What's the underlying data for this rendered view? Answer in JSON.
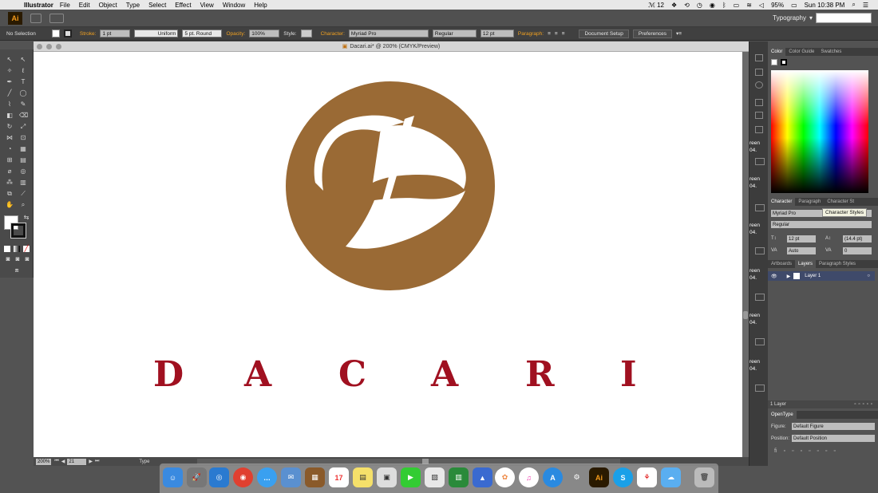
{
  "menubar": {
    "app_name": "Illustrator",
    "items": [
      "File",
      "Edit",
      "Object",
      "Type",
      "Select",
      "Effect",
      "View",
      "Window",
      "Help"
    ],
    "status": {
      "notifications": "12",
      "battery": "95%",
      "clock": "Sun 10:38 PM"
    }
  },
  "appbar": {
    "logo": "Ai",
    "workspace": "Typography"
  },
  "control": {
    "selection": "No Selection",
    "stroke_label": "Stroke:",
    "stroke_value": "1 pt",
    "profile": "Uniform",
    "brush": "5 pt. Round",
    "opacity_label": "Opacity:",
    "opacity_value": "100%",
    "style_label": "Style:",
    "character_label": "Character:",
    "font": "Myriad Pro",
    "font_style": "Regular",
    "font_size": "12 pt",
    "paragraph_label": "Paragraph:",
    "document_setup": "Document Setup",
    "preferences": "Preferences"
  },
  "document": {
    "title": "Dacari.ai* @ 200% (CMYK/Preview)",
    "wordmark": [
      "D",
      "A",
      "C",
      "A",
      "R",
      "I"
    ],
    "status_zoom": "200%",
    "status_page": "21",
    "status_tool": "Type"
  },
  "colors": {
    "logo_brown": "#9a6a35",
    "wordmark_red": "#a01020"
  },
  "side_strip": {
    "items": [
      "reen",
      "04.",
      "reen",
      "04.",
      "reen",
      "04.",
      "reen",
      "04.",
      "reen",
      "04.",
      "reen",
      "04."
    ]
  },
  "panels": {
    "color_tabs": [
      "Color",
      "Color Guide",
      "Swatches"
    ],
    "character_tabs": [
      "Character",
      "Paragraph",
      "Character St"
    ],
    "tooltip": "Character Styles",
    "char_font": "Myriad Pro",
    "char_style": "Regular",
    "char_size": "12 pt",
    "char_leading": "(14.4 pt)",
    "char_kerning": "Auto",
    "char_tracking": "0",
    "layers_tabs": [
      "Artboards",
      "Layers",
      "Paragraph Styles"
    ],
    "layer_name": "Layer 1",
    "layers_count": "1 Layer",
    "opentype_title": "OpenType",
    "figure_label": "Figure:",
    "figure_value": "Default Figure",
    "position_label": "Position:",
    "position_value": "Default Position"
  },
  "dock": {
    "items": [
      "finder-icon",
      "launchpad-icon",
      "safari-icon",
      "chrome-icon",
      "messages-icon",
      "mail-icon",
      "notes-icon",
      "calendar-icon",
      "stickies-icon",
      "preview-icon",
      "facetime-icon",
      "photos-icon",
      "numbers-icon",
      "keynote-icon",
      "photos-app-icon",
      "itunes-icon",
      "appstore-icon",
      "system-preferences-icon",
      "illustrator-icon",
      "skype-icon",
      "acrobat-icon",
      "icloud-icon",
      "trash-icon"
    ]
  }
}
